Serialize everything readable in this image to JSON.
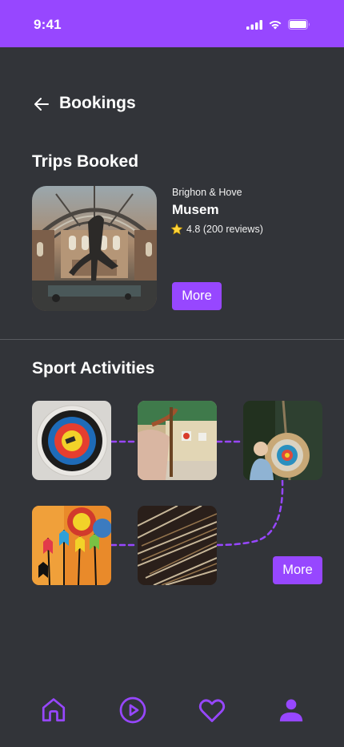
{
  "status_bar": {
    "time": "9:41",
    "icons": [
      "cellular-signal-icon",
      "wifi-icon",
      "battery-icon"
    ]
  },
  "header": {
    "back_icon": "arrow-left-icon",
    "title": "Bookings"
  },
  "trips": {
    "section_title": "Trips Booked",
    "card": {
      "image": "museum-hall-photo",
      "location": "Brighon & Hove",
      "name": "Musem",
      "rating_icon": "star-icon",
      "rating": "4.8 (200 reviews)",
      "more_label": "More"
    }
  },
  "sports": {
    "section_title": "Sport Activities",
    "tiles": [
      {
        "image": "archery-target-closeup"
      },
      {
        "image": "archer-drawing-bow"
      },
      {
        "image": "child-with-target"
      },
      {
        "image": "arrows-in-target"
      },
      {
        "image": "arrow-fletchings"
      }
    ],
    "more_label": "More"
  },
  "bottom_nav": {
    "items": [
      {
        "icon": "home-icon"
      },
      {
        "icon": "play-icon"
      },
      {
        "icon": "heart-icon"
      },
      {
        "icon": "profile-icon"
      }
    ]
  },
  "colors": {
    "accent": "#9747ff",
    "background": "#323439",
    "text": "#ffffff",
    "divider": "#595b60"
  }
}
